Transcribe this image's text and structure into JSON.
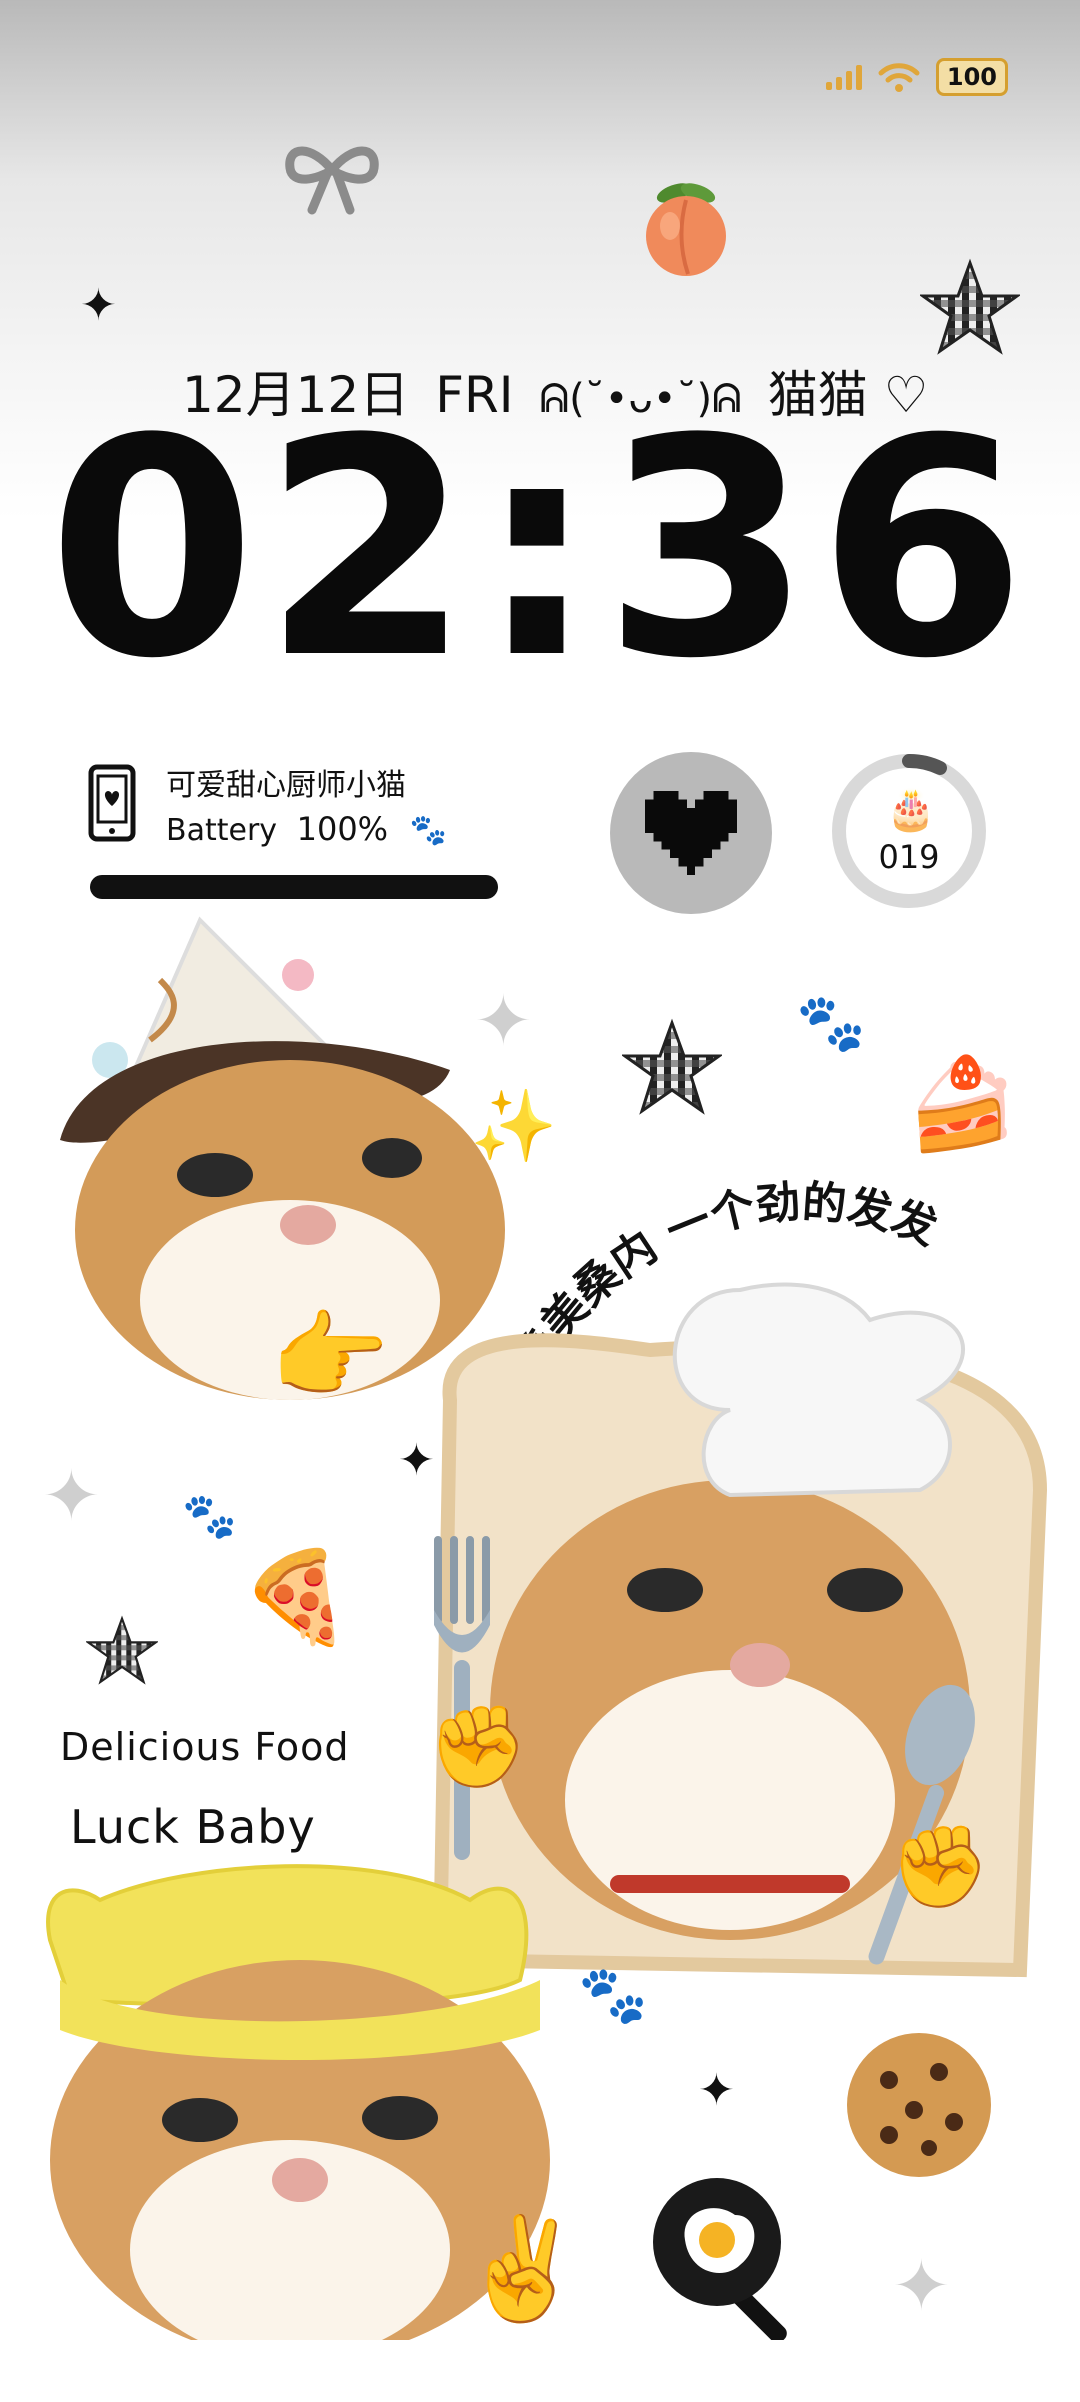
{
  "status_bar": {
    "battery_level": "100",
    "signal_icon": "signal-bars-icon",
    "wifi_icon": "wifi-icon"
  },
  "lock_screen": {
    "date": "12月12日",
    "weekday": "FRI",
    "kaomoji": "ᕱ(˘•ᴗ•˘)ᕱ",
    "tagline": "猫猫",
    "time": "02:36"
  },
  "battery_widget": {
    "title": "可爱甜心厨师小猫",
    "label": "Battery",
    "percent": "100%",
    "level": 1.0
  },
  "cake_widget": {
    "count": "019",
    "progress_fraction": 0.08
  },
  "decor_text": {
    "curved": "羡美桑内 一个劲的发发",
    "line1": "Delicious Food",
    "line2": "Luck Baby"
  },
  "colors": {
    "accent_amber": "#e0a63a",
    "widget_gray": "#b9b9b9",
    "ink": "#111111"
  }
}
